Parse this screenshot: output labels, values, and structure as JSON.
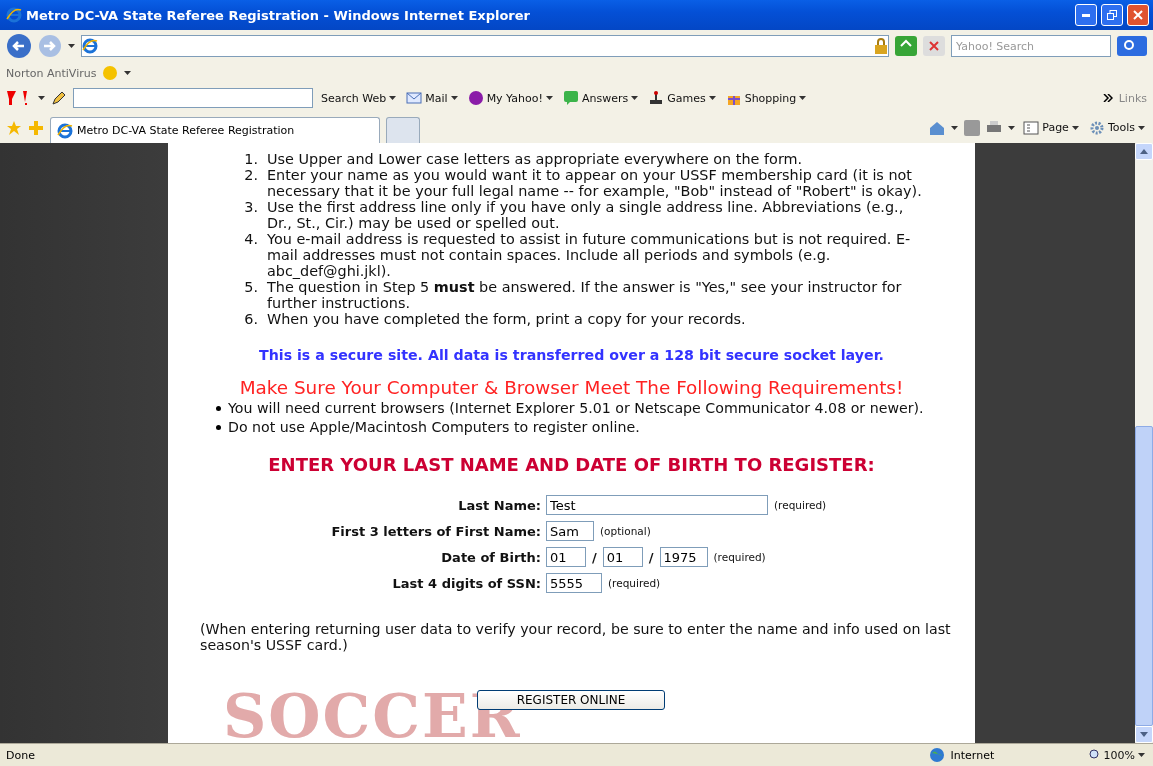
{
  "window": {
    "title": "Metro DC-VA State Referee Registration - Windows Internet Explorer"
  },
  "address_bar": {
    "search_placeholder": "Yahoo! Search"
  },
  "norton": {
    "label": "Norton AntiVirus"
  },
  "yahoo_toolbar": {
    "search_button": "Search Web",
    "links": "Links",
    "items": [
      {
        "kind": "mail",
        "label": "Mail"
      },
      {
        "kind": "myyahoo",
        "label": "My Yahoo!"
      },
      {
        "kind": "answers",
        "label": "Answers"
      },
      {
        "kind": "games",
        "label": "Games"
      },
      {
        "kind": "shopping",
        "label": "Shopping"
      }
    ]
  },
  "tabs": [
    {
      "label": "Metro DC-VA State Referee Registration",
      "selected": true
    }
  ],
  "command_bar": {
    "items": [
      {
        "kind": "page",
        "label": "Page"
      },
      {
        "kind": "tools",
        "label": "Tools"
      }
    ]
  },
  "page": {
    "instructions": [
      {
        "number": "1.",
        "text": "Use Upper and Lower case letters as appropriate everywhere on the form."
      },
      {
        "number": "2.",
        "text": "Enter your name as you would want it to appear on your USSF membership card (it is not necessary that it be your full legal name -- for example, \"Bob\" instead of \"Robert\" is okay)."
      },
      {
        "number": "3.",
        "text": "Use the first address line only if you have only a single address line. Abbreviations (e.g., Dr., St., Cir.) may be used or spelled out."
      },
      {
        "number": "4.",
        "text": "You e-mail address is requested to assist in future communications but is not required. E-mail addresses must not contain spaces. Include all periods and symbols (e.g. abc_def@ghi.jkl)."
      },
      {
        "number": "5.",
        "text": "The question in Step 5 **must** be answered. If the answer is \"Yes,\" see your instructor for further instructions."
      },
      {
        "number": "6.",
        "text": "When you have completed the form, print a copy for your records."
      }
    ],
    "secure_notice": "This is a secure site. All data is transferred over a 128 bit secure socket layer.",
    "requirements_heading": "Make Sure Your Computer & Browser Meet The Following Requirements!",
    "requirements": [
      "You will need current browsers (Internet Explorer 5.01 or Netscape Communicator 4.08 or newer).",
      "Do not use Apple/Macintosh Computers to register online."
    ],
    "form_heading": "ENTER YOUR LAST NAME AND DATE OF BIRTH TO REGISTER:",
    "fields": [
      {
        "kind": "wide",
        "label": "Last Name:",
        "values": [
          "Test"
        ],
        "hint": "(required)"
      },
      {
        "kind": "short",
        "label": "First 3 letters of First Name:",
        "values": [
          "Sam"
        ],
        "hint": "(optional)"
      },
      {
        "kind": "date",
        "label": "Date of Birth:",
        "values": [
          "01",
          "01",
          "1975"
        ],
        "separators": [
          "/",
          "/"
        ],
        "hint": "(required)"
      },
      {
        "kind": "short",
        "label": "Last 4 digits of SSN:",
        "values": [
          "5555"
        ],
        "hint": "(required)"
      }
    ],
    "note": "(When entering returning user data to verify your record, be sure to enter the name and info used on last season's USSF card.)",
    "submit": "REGISTER ONLINE",
    "background_text": "SOCCER"
  },
  "status_bar": {
    "text": "Done",
    "zone": "Internet",
    "zoom": "100%"
  }
}
